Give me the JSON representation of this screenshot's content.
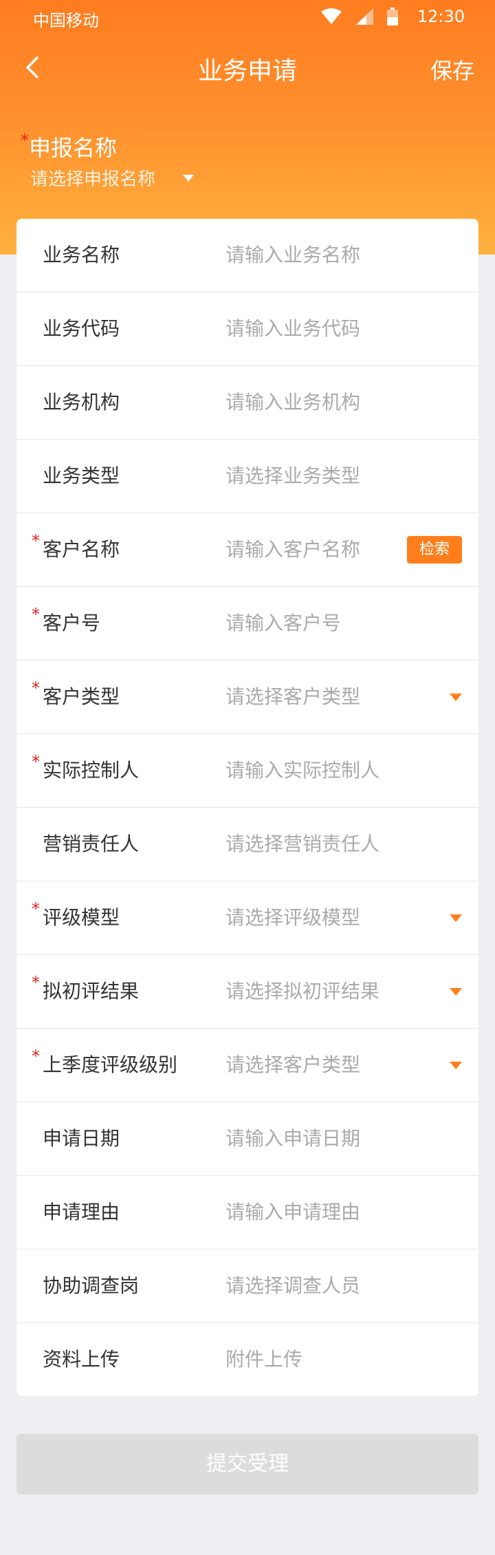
{
  "status_bar": {
    "carrier": "中国移动",
    "time": "12:30"
  },
  "nav": {
    "title": "业务申请",
    "save_label": "保存",
    "back_icon": "chevron-left-icon"
  },
  "apply_name": {
    "label": "申报名称",
    "placeholder": "请选择申报名称"
  },
  "form": {
    "rows": [
      {
        "label": "业务名称",
        "placeholder": "请输入业务名称",
        "required": false
      },
      {
        "label": "业务代码",
        "placeholder": "请输入业务代码",
        "required": false
      },
      {
        "label": "业务机构",
        "placeholder": "请输入业务机构",
        "required": false
      },
      {
        "label": "业务类型",
        "placeholder": "请选择业务类型",
        "required": false
      },
      {
        "label": "客户名称",
        "placeholder": "请输入客户名称",
        "required": true,
        "button": "检索"
      },
      {
        "label": "客户号",
        "placeholder": "请输入客户号",
        "required": true
      },
      {
        "label": "客户类型",
        "placeholder": "请选择客户类型",
        "required": true,
        "dropdown": true
      },
      {
        "label": "实际控制人",
        "placeholder": "请输入实际控制人",
        "required": true
      },
      {
        "label": "营销责任人",
        "placeholder": "请选择营销责任人",
        "required": false
      },
      {
        "label": "评级模型",
        "placeholder": "请选择评级模型",
        "required": true,
        "dropdown": true
      },
      {
        "label": "拟初评结果",
        "placeholder": "请选择拟初评结果",
        "required": true,
        "dropdown": true
      },
      {
        "label": "上季度评级级别",
        "placeholder": "请选择客户类型",
        "required": true,
        "dropdown": true
      },
      {
        "label": "申请日期",
        "placeholder": "请输入申请日期",
        "required": false
      },
      {
        "label": "申请理由",
        "placeholder": "请输入申请理由",
        "required": false
      },
      {
        "label": "协助调查岗",
        "placeholder": "请选择调查人员",
        "required": false
      },
      {
        "label": "资料上传",
        "placeholder": "附件上传",
        "required": false
      }
    ]
  },
  "submit_label": "提交受理",
  "required_mark": "*",
  "colors": {
    "accent": "#ff7e1c",
    "required": "#e4211b",
    "placeholder": "#aaaaaa",
    "submit_bg": "#dcdcdc"
  }
}
